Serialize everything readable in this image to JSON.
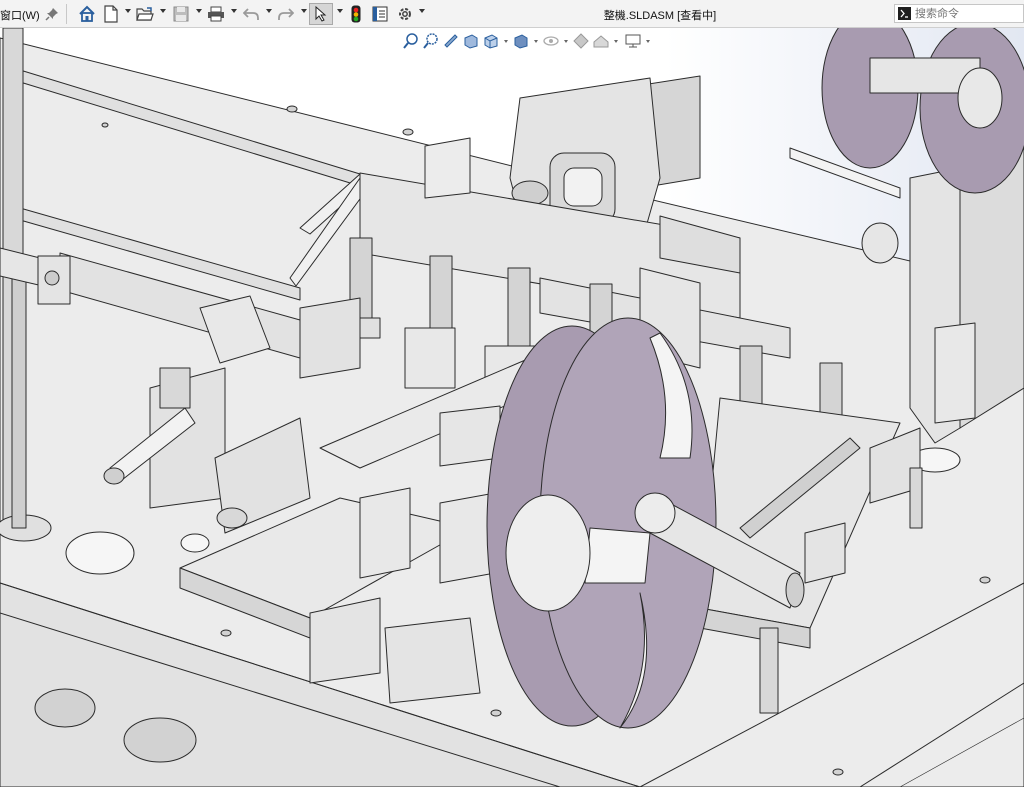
{
  "menu": {
    "window_label": "窗口(W)"
  },
  "document": {
    "title": "整機.SLDASM [查看中]"
  },
  "search": {
    "placeholder": "搜索命令"
  },
  "toolbar": {
    "icons": [
      "pin-icon",
      "home-icon",
      "new-document-icon",
      "open-folder-icon",
      "save-icon",
      "print-icon",
      "undo-icon",
      "redo-icon",
      "select-arrow-icon",
      "traffic-light-icon",
      "file-properties-icon",
      "options-gear-icon"
    ]
  },
  "heads_up_toolbar": {
    "icons": [
      "zoom-to-fit-icon",
      "zoom-to-area-icon",
      "previous-view-icon",
      "section-view-icon",
      "view-orientation-icon",
      "display-style-icon",
      "hide-show-items-icon",
      "edit-appearance-icon",
      "apply-scene-icon",
      "view-settings-icon"
    ]
  },
  "colors": {
    "toolbar_bg": "#f3f3f3",
    "model_metal": "#e7e7e7",
    "model_edge": "#2b2b2b",
    "reel_purple": "#a89bb0",
    "active_tool": "#d6d6d6"
  }
}
